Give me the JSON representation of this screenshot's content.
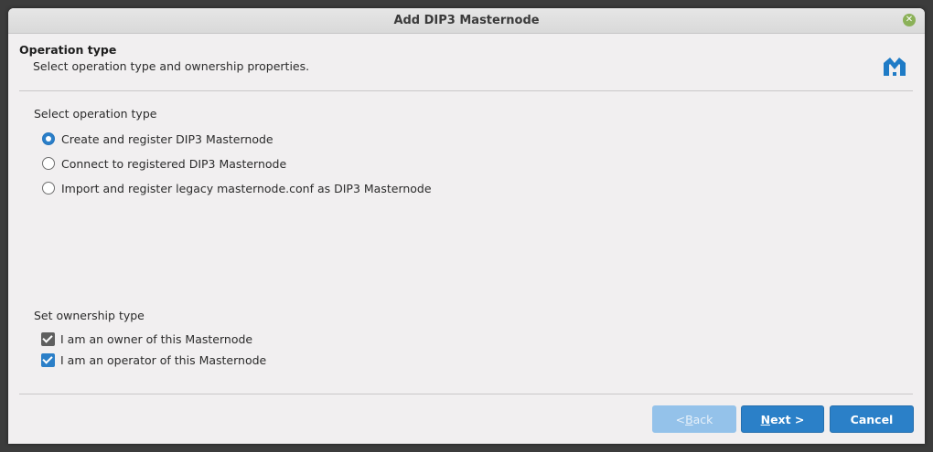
{
  "window": {
    "title": "Add DIP3 Masternode"
  },
  "header": {
    "title": "Operation type",
    "subtitle": "Select operation type and ownership properties.",
    "logo_icon": "dash-logo-icon"
  },
  "operation": {
    "label": "Select operation type",
    "options": [
      {
        "label": "Create and register DIP3 Masternode",
        "checked": true
      },
      {
        "label": "Connect to registered DIP3 Masternode",
        "checked": false
      },
      {
        "label": "Import and register legacy masternode.conf as DIP3 Masternode",
        "checked": false
      }
    ]
  },
  "ownership": {
    "label": "Set ownership type",
    "options": [
      {
        "label": "I am an owner of this Masternode",
        "checked": true
      },
      {
        "label": "I am an operator of this Masternode",
        "checked": true
      }
    ]
  },
  "buttons": {
    "back": {
      "prefix": "< ",
      "mnemonic": "B",
      "rest": "ack",
      "enabled": false
    },
    "next": {
      "mnemonic": "N",
      "rest": "ext >"
    },
    "cancel": "Cancel"
  },
  "colors": {
    "accent": "#2b80c8",
    "disabled": "#94c2ea",
    "close": "#8bb158"
  }
}
